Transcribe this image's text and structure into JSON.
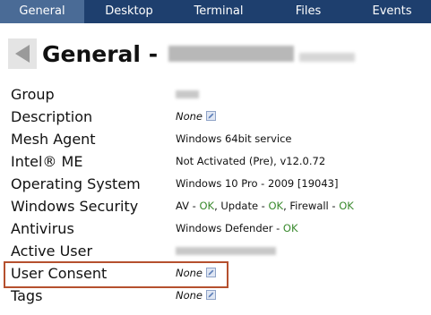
{
  "tabs": [
    {
      "label": "General",
      "active": true
    },
    {
      "label": "Desktop",
      "active": false
    },
    {
      "label": "Terminal",
      "active": false
    },
    {
      "label": "Files",
      "active": false
    },
    {
      "label": "Events",
      "active": false
    }
  ],
  "header": {
    "title": "General -"
  },
  "rows": {
    "group": {
      "label": "Group"
    },
    "description": {
      "label": "Description",
      "value": "None"
    },
    "mesh_agent": {
      "label": "Mesh Agent",
      "value": "Windows 64bit service"
    },
    "intel_me": {
      "label": "Intel® ME",
      "value": "Not Activated (Pre), v12.0.72"
    },
    "os": {
      "label": "Operating System",
      "value": "Windows 10 Pro - 2009 [19043]"
    },
    "windows_security": {
      "label": "Windows Security",
      "av": "AV - ",
      "av_status": "OK",
      "update": ", Update - ",
      "update_status": "OK",
      "firewall": ", Firewall - ",
      "firewall_status": "OK"
    },
    "antivirus": {
      "label": "Antivirus",
      "product": "Windows Defender - ",
      "status": "OK"
    },
    "active_user": {
      "label": "Active User"
    },
    "user_consent": {
      "label": "User Consent",
      "value": "None"
    },
    "tags": {
      "label": "Tags",
      "value": "None"
    }
  },
  "colors": {
    "tabbar": "#1e3f6e",
    "tab_active": "#4a6b96",
    "ok": "#3a8a2e",
    "highlight_border": "#b5502e"
  },
  "icons": {
    "back": "triangle-left-icon",
    "edit": "pencil-edit-icon"
  }
}
